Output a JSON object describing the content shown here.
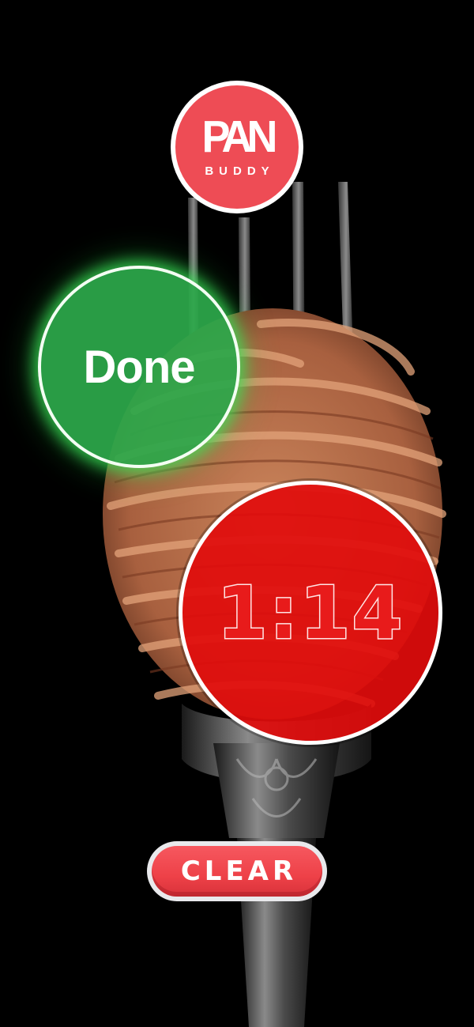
{
  "app": {
    "logo_word": "PAN",
    "logo_sub": "BUDDY"
  },
  "done_button": {
    "label": "Done"
  },
  "timer": {
    "value": "1:14"
  },
  "clear_button": {
    "label": "CLEAR"
  },
  "colors": {
    "background": "#000000",
    "brand": "#ee4c55",
    "done_green": "#2ca84a",
    "timer_red": "#e10c0c"
  }
}
